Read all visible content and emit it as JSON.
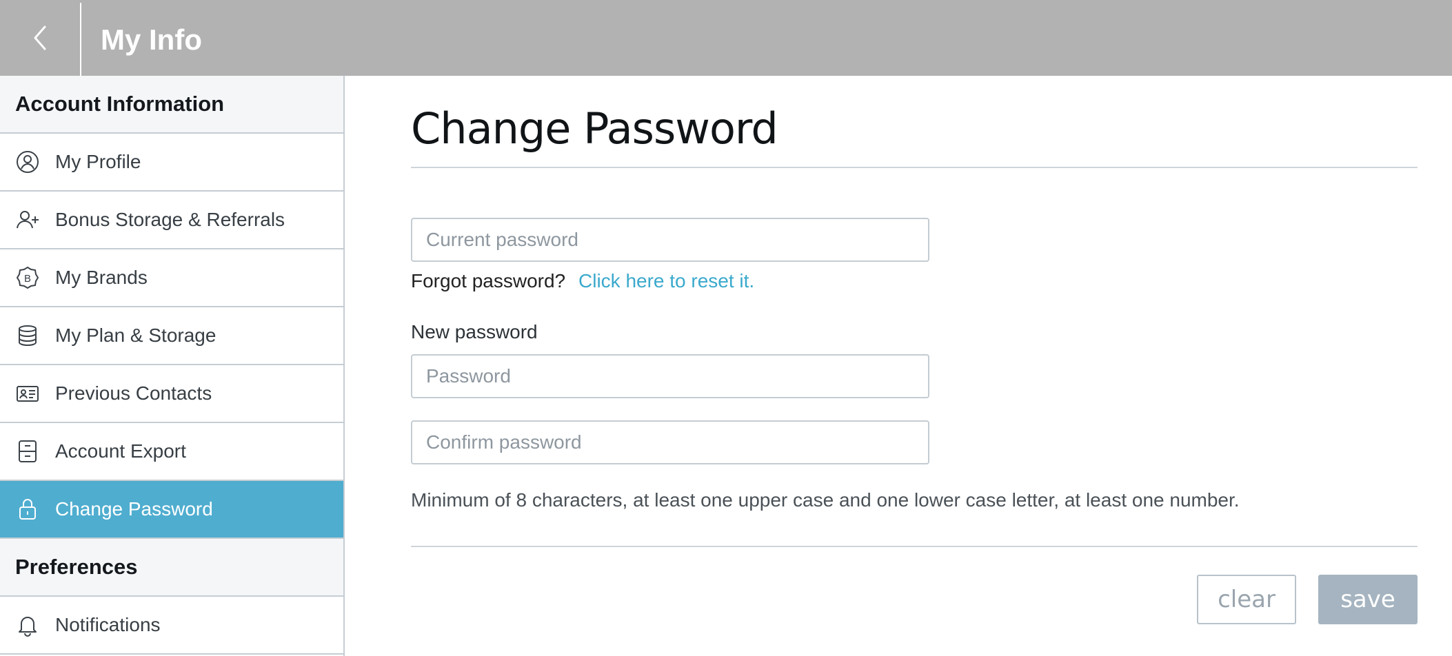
{
  "header": {
    "title": "My Info",
    "back_icon": "chevron-left-icon"
  },
  "sidebar": {
    "section1_title": "Account Information",
    "items": [
      {
        "label": "My Profile",
        "icon": "user-circle-icon"
      },
      {
        "label": "Bonus Storage & Referrals",
        "icon": "user-plus-icon"
      },
      {
        "label": "My Brands",
        "icon": "brand-badge-icon"
      },
      {
        "label": "My Plan & Storage",
        "icon": "database-icon"
      },
      {
        "label": "Previous Contacts",
        "icon": "contact-card-icon"
      },
      {
        "label": "Account Export",
        "icon": "archive-icon"
      },
      {
        "label": "Change Password",
        "icon": "lock-icon",
        "active": true
      }
    ],
    "section2_title": "Preferences",
    "items2": [
      {
        "label": "Notifications",
        "icon": "bell-icon"
      }
    ]
  },
  "main": {
    "title": "Change Password",
    "current_password_placeholder": "Current password",
    "forgot_text": "Forgot password?",
    "reset_link": "Click here to reset it.",
    "new_password_label": "New password",
    "password_placeholder": "Password",
    "confirm_placeholder": "Confirm password",
    "hint": "Minimum of 8 characters, at least one upper case and one lower case letter, at least one number.",
    "clear_label": "clear",
    "save_label": "save"
  },
  "colors": {
    "header_bg": "#b2b2b2",
    "accent": "#4fadcf",
    "link": "#3aa9cc",
    "save_bg": "#a5b4c0"
  }
}
